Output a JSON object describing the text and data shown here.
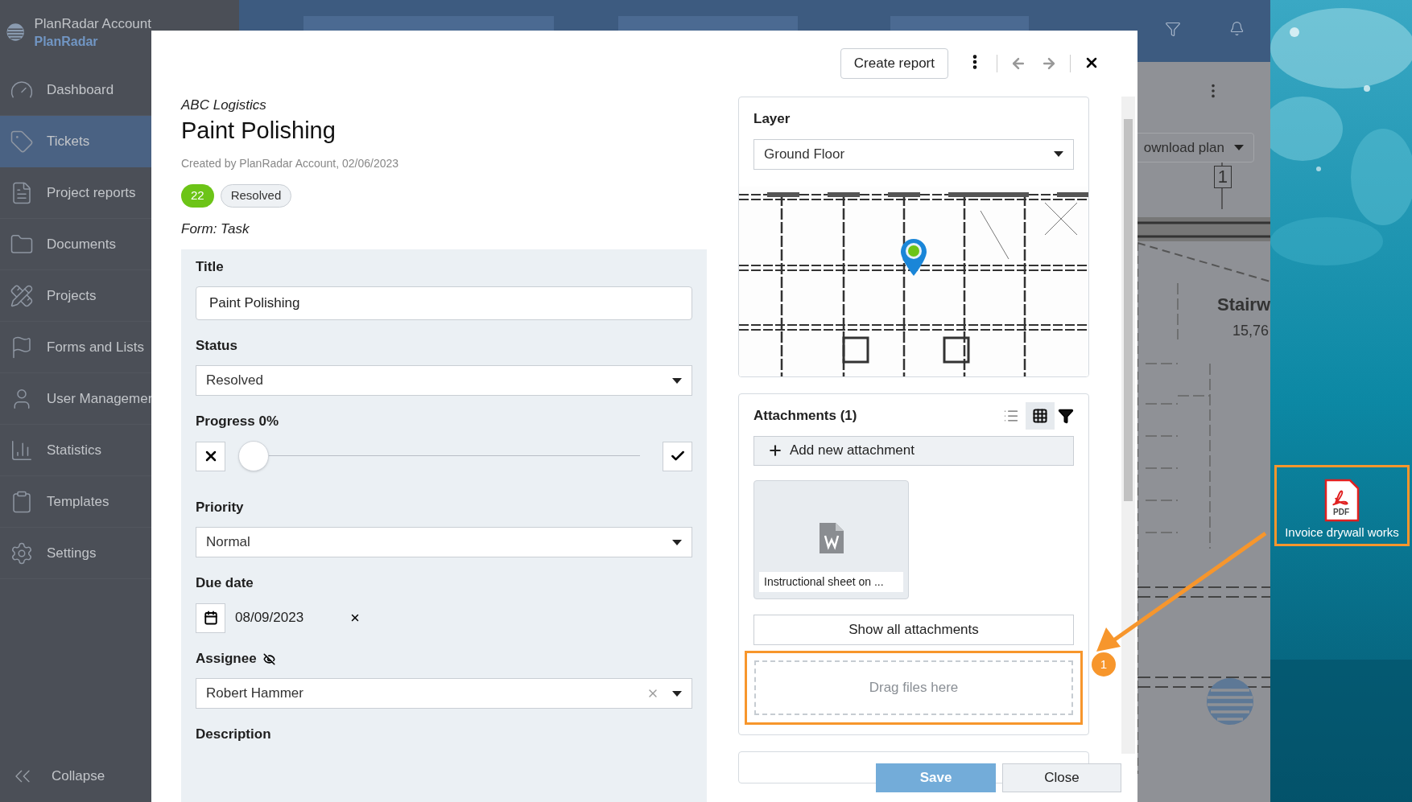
{
  "app": {
    "account_name": "PlanRadar Account",
    "brand": "PlanRadar"
  },
  "sidebar": {
    "items": [
      {
        "label": "Dashboard",
        "selected": false
      },
      {
        "label": "Tickets",
        "selected": true
      },
      {
        "label": "Project reports",
        "selected": false
      },
      {
        "label": "Documents",
        "selected": false
      },
      {
        "label": "Projects",
        "selected": false
      },
      {
        "label": "Forms and Lists",
        "selected": false
      },
      {
        "label": "User Managemer",
        "selected": false
      },
      {
        "label": "Statistics",
        "selected": false
      },
      {
        "label": "Templates",
        "selected": false
      },
      {
        "label": "Settings",
        "selected": false
      }
    ],
    "collapse": "Collapse"
  },
  "background_view": {
    "download_button": "ownload plan",
    "plan_number": "1",
    "room_name": "Stairw",
    "room_area": "15,76"
  },
  "modal": {
    "create_report": "Create report",
    "project": "ABC Logistics",
    "title": "Paint Polishing",
    "created": "Created by PlanRadar Account, 02/06/2023",
    "number_badge": "22",
    "status_badge": "Resolved",
    "form_label": "Form: Task",
    "fields": [
      {
        "kind": "text",
        "label": "Title",
        "value": "Paint Polishing"
      },
      {
        "kind": "select",
        "label": "Status",
        "value": "Resolved"
      },
      {
        "kind": "slider",
        "label": "Progress 0%",
        "level": 0
      },
      {
        "kind": "select",
        "label": "Priority",
        "value": "Normal"
      },
      {
        "kind": "date",
        "label": "Due date",
        "value": "08/09/2023"
      },
      {
        "kind": "select",
        "label": "Assignee",
        "value": "Robert Hammer",
        "clearable": true,
        "hidden": true
      },
      {
        "kind": "heading",
        "label": "Description"
      }
    ],
    "layer": {
      "title": "Layer",
      "value": "Ground Floor"
    },
    "attachments": {
      "title": "Attachments (1)",
      "views": [
        {
          "selected": false
        },
        {
          "selected": true
        }
      ],
      "add": "Add new attachment",
      "files": [
        {
          "name": "Instructional sheet on ..."
        }
      ],
      "show_all": "Show all attachments",
      "drop_zone": "Drag files here"
    },
    "footer": {
      "save": "Save",
      "close": "Close"
    }
  },
  "desktop": {
    "file_name": "Invoice drywall works",
    "file_type": "PDF",
    "step_badge": "1"
  }
}
